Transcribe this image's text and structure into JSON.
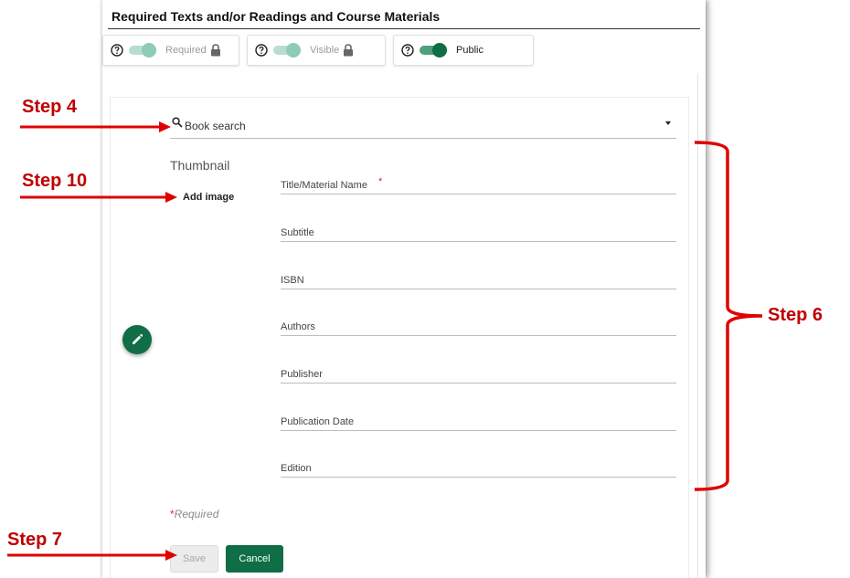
{
  "section": {
    "title": "Required Texts and/or Readings and Course Materials"
  },
  "toggles": [
    {
      "label": "Required",
      "state": "disabled-on",
      "locked": true
    },
    {
      "label": "Visible",
      "state": "disabled-on",
      "locked": true
    },
    {
      "label": "Public",
      "state": "on",
      "locked": false
    }
  ],
  "book_search": {
    "placeholder": "Book search"
  },
  "thumbnail": {
    "label": "Thumbnail",
    "add_image": "Add image"
  },
  "fields": {
    "title": {
      "placeholder": "Title/Material Name",
      "required_mark": "*"
    },
    "subtitle": {
      "placeholder": "Subtitle"
    },
    "isbn": {
      "placeholder": "ISBN"
    },
    "authors": {
      "placeholder": "Authors"
    },
    "publisher": {
      "placeholder": "Publisher"
    },
    "publication_date": {
      "placeholder": "Publication Date"
    },
    "edition": {
      "placeholder": "Edition"
    }
  },
  "required_note": {
    "star": "*",
    "text": "Required"
  },
  "buttons": {
    "save": "Save",
    "cancel": "Cancel"
  },
  "annotations": {
    "step4": "Step 4",
    "step10": "Step 10",
    "step6": "Step 6",
    "step7": "Step 7"
  },
  "colors": {
    "primary": "#0f6e45",
    "annotation": "#e00000",
    "required": "#d32f2f"
  },
  "icons": {
    "help": "help-circle-icon",
    "lock": "lock-icon",
    "search": "search-icon",
    "edit": "pencil-icon",
    "dropdown": "caret-down-icon"
  }
}
